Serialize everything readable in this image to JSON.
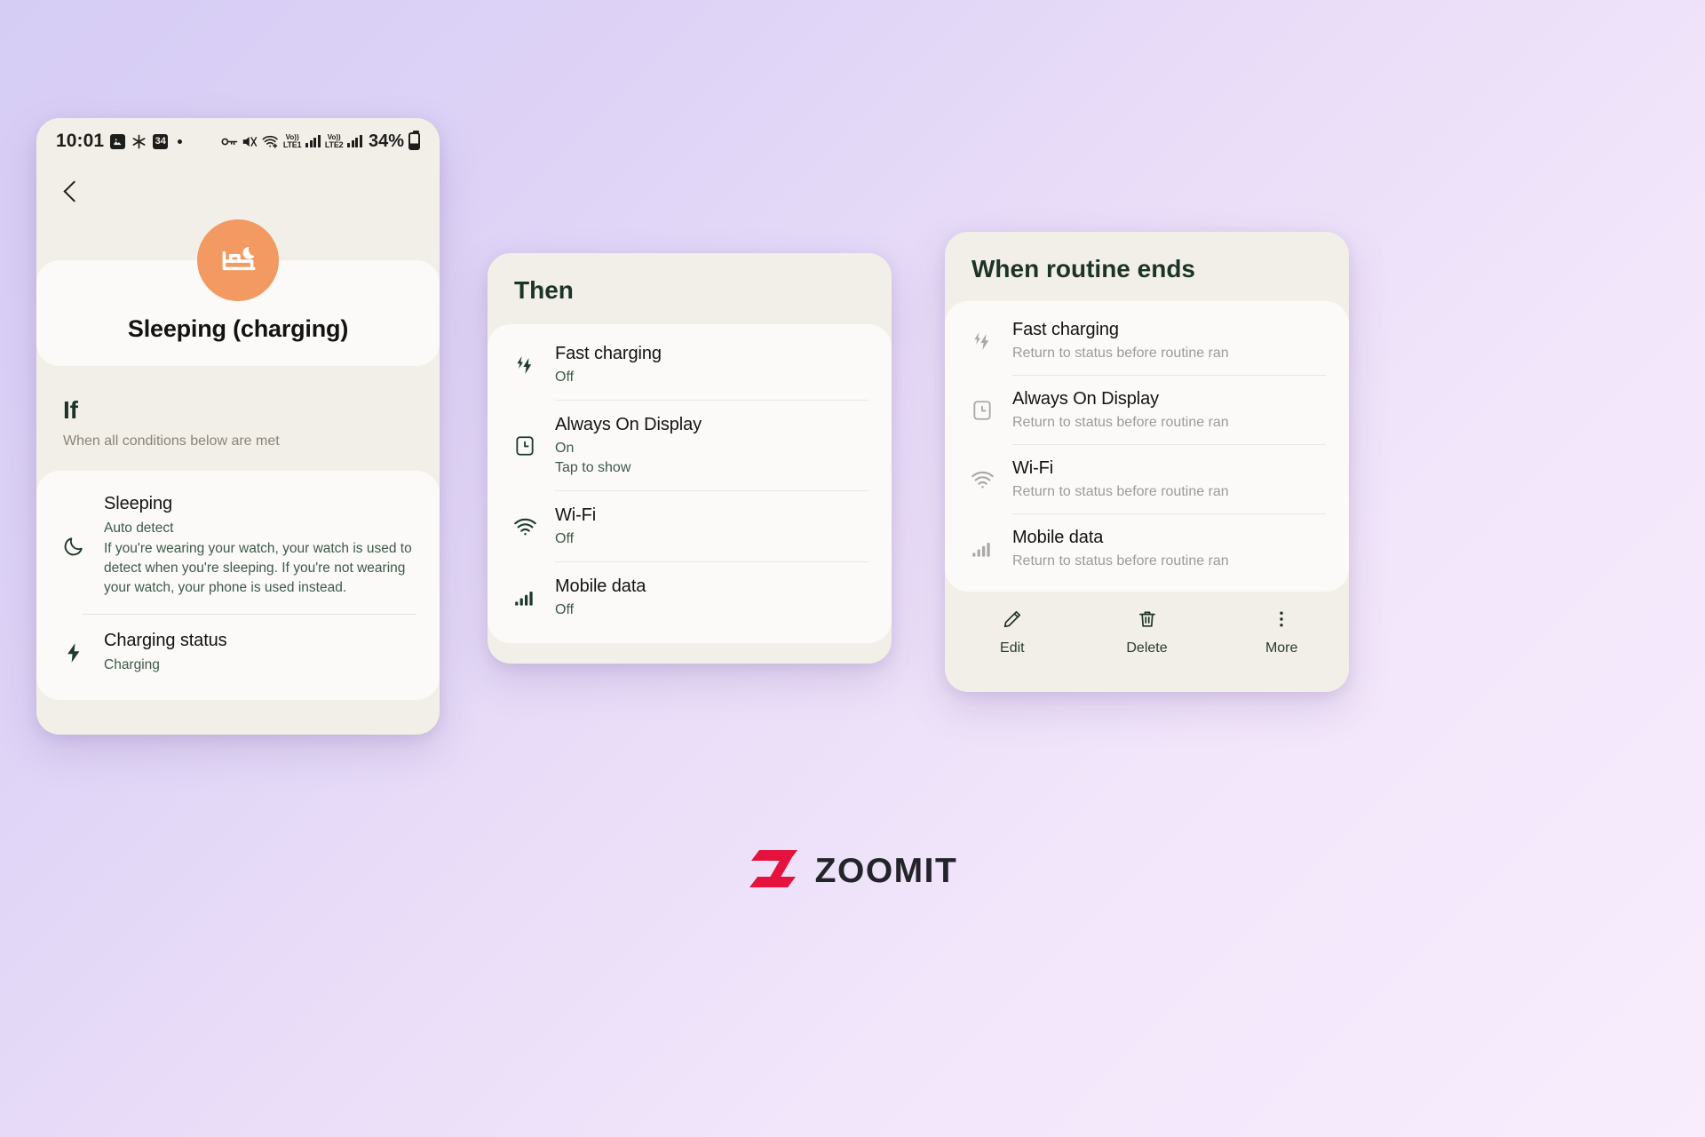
{
  "phone": {
    "status_bar": {
      "time": "10:01",
      "icons": [
        "image-icon",
        "snowflake-icon",
        "calendar-34-icon",
        "dot-icon"
      ],
      "right_icons": [
        "vpn-key-icon",
        "mute-icon",
        "wifi-calling-icon"
      ],
      "network_1": {
        "vo": "Vo))",
        "label": "LTE1"
      },
      "network_2": {
        "vo": "Vo))",
        "label": "LTE2"
      },
      "battery_text": "34%"
    },
    "back_button": "back-icon",
    "routine": {
      "icon": "sleeping-bed-moon-icon",
      "accent_color": "#f29a62",
      "title": "Sleeping (charging)"
    },
    "if_section": {
      "title": "If",
      "subtitle": "When all conditions below are met",
      "conditions": [
        {
          "icon": "moon-icon",
          "title": "Sleeping",
          "value": "Auto detect",
          "description": "If you're wearing your watch, your watch is used to detect when you're sleeping. If you're not wearing your watch, your phone is used instead."
        },
        {
          "icon": "bolt-icon",
          "title": "Charging status",
          "value": "Charging",
          "description": ""
        }
      ]
    }
  },
  "then_card": {
    "title": "Then",
    "actions": [
      {
        "icon": "fast-charging-icon",
        "title": "Fast charging",
        "value": "Off",
        "extra": ""
      },
      {
        "icon": "always-on-display-icon",
        "title": "Always On Display",
        "value": "On",
        "extra": "Tap to show"
      },
      {
        "icon": "wifi-icon",
        "title": "Wi-Fi",
        "value": "Off",
        "extra": ""
      },
      {
        "icon": "mobile-data-icon",
        "title": "Mobile data",
        "value": "Off",
        "extra": ""
      }
    ]
  },
  "ends_card": {
    "title": "When routine ends",
    "items": [
      {
        "icon": "fast-charging-icon",
        "title": "Fast charging",
        "value": "Return to status before routine ran"
      },
      {
        "icon": "always-on-display-icon",
        "title": "Always On Display",
        "value": "Return to status before routine ran"
      },
      {
        "icon": "wifi-icon",
        "title": "Wi-Fi",
        "value": "Return to status before routine ran"
      },
      {
        "icon": "mobile-data-icon",
        "title": "Mobile data",
        "value": "Return to status before routine ran"
      }
    ],
    "actions": [
      {
        "icon": "pencil-icon",
        "label": "Edit"
      },
      {
        "icon": "trash-icon",
        "label": "Delete"
      },
      {
        "icon": "more-vertical-icon",
        "label": "More"
      }
    ]
  },
  "brand": {
    "name": "ZOOMIT",
    "mark_color": "#e4123c",
    "text_color": "#23242a"
  },
  "theme": {
    "card_bg": "#f2efe8",
    "inner_bg": "#fbfaf8",
    "heading_green": "#1c3327",
    "muted": "#8d8276",
    "disabled": "#9b9b99"
  }
}
